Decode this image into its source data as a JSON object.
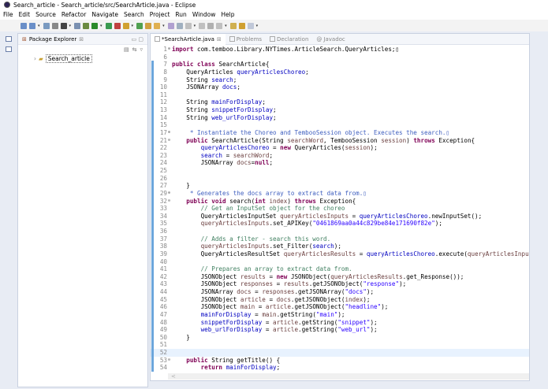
{
  "window": {
    "title": "Search_article - Search_article/src/SearchArticle.java - Eclipse"
  },
  "menu": [
    "File",
    "Edit",
    "Source",
    "Refactor",
    "Navigate",
    "Search",
    "Project",
    "Run",
    "Window",
    "Help"
  ],
  "package_explorer": {
    "title": "Package Explorer",
    "close": "⊠",
    "project": "Search_article"
  },
  "tabs": [
    {
      "label": "*SearchArticle.java",
      "active": true
    },
    {
      "label": "Problems"
    },
    {
      "label": "Declaration"
    },
    {
      "label": "Javadoc"
    }
  ],
  "code": [
    {
      "n": "1",
      "m": "⊕",
      "t": [
        [
          "k",
          "import "
        ],
        [
          "t",
          "com.temboo.Library.NYTimes.ArticleSearch.QueryArticles;▯"
        ]
      ]
    },
    {
      "n": "6",
      "t": []
    },
    {
      "n": "7",
      "t": [
        [
          "k",
          "public class "
        ],
        [
          "t",
          "SearchArticle{"
        ]
      ]
    },
    {
      "n": "8",
      "t": [
        [
          "t",
          "    QueryArticles "
        ],
        [
          "f",
          "queryArticlesChoreo"
        ],
        [
          "t",
          ";"
        ]
      ]
    },
    {
      "n": "9",
      "t": [
        [
          "t",
          "    String "
        ],
        [
          "f",
          "search"
        ],
        [
          "t",
          ";"
        ]
      ]
    },
    {
      "n": "10",
      "t": [
        [
          "t",
          "    JSONArray "
        ],
        [
          "f",
          "docs"
        ],
        [
          "t",
          ";"
        ]
      ]
    },
    {
      "n": "11",
      "t": []
    },
    {
      "n": "12",
      "t": [
        [
          "t",
          "    String "
        ],
        [
          "f",
          "mainForDisplay"
        ],
        [
          "t",
          ";"
        ]
      ]
    },
    {
      "n": "13",
      "t": [
        [
          "t",
          "    String "
        ],
        [
          "f",
          "snippetForDisplay"
        ],
        [
          "t",
          ";"
        ]
      ]
    },
    {
      "n": "14",
      "t": [
        [
          "t",
          "    String "
        ],
        [
          "f",
          "web_urlForDisplay"
        ],
        [
          "t",
          ";"
        ]
      ]
    },
    {
      "n": "15",
      "t": []
    },
    {
      "n": "17",
      "m": "⊕",
      "t": [
        [
          "jd",
          "     * Instantiate the Choreo and TembooSession object. Executes the search.▯"
        ]
      ]
    },
    {
      "n": "21",
      "m": "⊖",
      "t": [
        [
          "k",
          "    public "
        ],
        [
          "t",
          "SearchArticle(String "
        ],
        [
          "v",
          "searchWord"
        ],
        [
          "t",
          ", TembooSession "
        ],
        [
          "v",
          "session"
        ],
        [
          "t",
          ") "
        ],
        [
          "k",
          "throws "
        ],
        [
          "t",
          "Exception{"
        ]
      ]
    },
    {
      "n": "22",
      "t": [
        [
          "f",
          "        queryArticlesChoreo"
        ],
        [
          "t",
          " = "
        ],
        [
          "k",
          "new "
        ],
        [
          "t",
          "QueryArticles("
        ],
        [
          "v",
          "session"
        ],
        [
          "t",
          ");"
        ]
      ]
    },
    {
      "n": "23",
      "t": [
        [
          "f",
          "        search"
        ],
        [
          "t",
          " = "
        ],
        [
          "v",
          "searchWord"
        ],
        [
          "t",
          ";"
        ]
      ]
    },
    {
      "n": "24",
      "t": [
        [
          "t",
          "        JSONArray "
        ],
        [
          "v",
          "docs"
        ],
        [
          "t",
          "="
        ],
        [
          "k",
          "null"
        ],
        [
          "t",
          ";"
        ]
      ]
    },
    {
      "n": "25",
      "t": []
    },
    {
      "n": "26",
      "t": []
    },
    {
      "n": "27",
      "t": [
        [
          "t",
          "    }"
        ]
      ]
    },
    {
      "n": "29",
      "m": "⊕",
      "t": [
        [
          "jd",
          "     * Generates the docs array to extract data from.▯"
        ]
      ]
    },
    {
      "n": "32",
      "m": "⊖",
      "t": [
        [
          "k",
          "    public void "
        ],
        [
          "t",
          "search("
        ],
        [
          "k",
          "int "
        ],
        [
          "v",
          "index"
        ],
        [
          "t",
          ") "
        ],
        [
          "k",
          "throws "
        ],
        [
          "t",
          "Exception{"
        ]
      ]
    },
    {
      "n": "33",
      "t": [
        [
          "c",
          "        // Get an InputSet object for the choreo"
        ]
      ]
    },
    {
      "n": "34",
      "t": [
        [
          "t",
          "        QueryArticlesInputSet "
        ],
        [
          "v",
          "queryArticlesInputs"
        ],
        [
          "t",
          " = "
        ],
        [
          "f",
          "queryArticlesChoreo"
        ],
        [
          "t",
          ".newInputSet();"
        ]
      ]
    },
    {
      "n": "35",
      "t": [
        [
          "v",
          "        queryArticlesInputs"
        ],
        [
          "t",
          ".set_APIKey("
        ],
        [
          "s",
          "\"0461869aa0a44c829be84e171690f82e\""
        ],
        [
          "t",
          ");"
        ]
      ]
    },
    {
      "n": "36",
      "t": []
    },
    {
      "n": "37",
      "t": [
        [
          "c",
          "        // Adds a filter - search this word."
        ]
      ]
    },
    {
      "n": "38",
      "t": [
        [
          "v",
          "        queryArticlesInputs"
        ],
        [
          "t",
          ".set_Filter("
        ],
        [
          "f",
          "search"
        ],
        [
          "t",
          ");"
        ]
      ]
    },
    {
      "n": "39",
      "t": [
        [
          "t",
          "        QueryArticlesResultSet "
        ],
        [
          "v",
          "queryArticlesResults"
        ],
        [
          "t",
          " = "
        ],
        [
          "f",
          "queryArticlesChoreo"
        ],
        [
          "t",
          ".execute("
        ],
        [
          "v",
          "queryArticlesInputs"
        ],
        [
          "t",
          ");"
        ]
      ]
    },
    {
      "n": "40",
      "t": []
    },
    {
      "n": "41",
      "t": [
        [
          "c",
          "        // Prepares an array to extract data from."
        ]
      ]
    },
    {
      "n": "42",
      "t": [
        [
          "t",
          "        JSONObject "
        ],
        [
          "v",
          "results"
        ],
        [
          "t",
          " = "
        ],
        [
          "k",
          "new "
        ],
        [
          "t",
          "JSONObject("
        ],
        [
          "v",
          "queryArticlesResults"
        ],
        [
          "t",
          ".get_Response());"
        ]
      ]
    },
    {
      "n": "43",
      "t": [
        [
          "t",
          "        JSONObject "
        ],
        [
          "v",
          "responses"
        ],
        [
          "t",
          " = "
        ],
        [
          "v",
          "results"
        ],
        [
          "t",
          ".getJSONObject("
        ],
        [
          "s",
          "\"response\""
        ],
        [
          "t",
          ");"
        ]
      ]
    },
    {
      "n": "44",
      "t": [
        [
          "t",
          "        JSONArray "
        ],
        [
          "v",
          "docs"
        ],
        [
          "t",
          " = "
        ],
        [
          "v",
          "responses"
        ],
        [
          "t",
          ".getJSONArray("
        ],
        [
          "s",
          "\"docs\""
        ],
        [
          "t",
          ");"
        ]
      ]
    },
    {
      "n": "45",
      "t": [
        [
          "t",
          "        JSONObject "
        ],
        [
          "v",
          "article"
        ],
        [
          "t",
          " = "
        ],
        [
          "v",
          "docs"
        ],
        [
          "t",
          ".getJSONObject("
        ],
        [
          "v",
          "index"
        ],
        [
          "t",
          ");"
        ]
      ]
    },
    {
      "n": "46",
      "t": [
        [
          "t",
          "        JSONObject "
        ],
        [
          "v",
          "main"
        ],
        [
          "t",
          " = "
        ],
        [
          "v",
          "article"
        ],
        [
          "t",
          ".getJSONObject("
        ],
        [
          "s",
          "\"headline\""
        ],
        [
          "t",
          ");"
        ]
      ]
    },
    {
      "n": "47",
      "t": [
        [
          "f",
          "        mainForDisplay"
        ],
        [
          "t",
          " = "
        ],
        [
          "v",
          "main"
        ],
        [
          "t",
          ".getString("
        ],
        [
          "s",
          "\"main\""
        ],
        [
          "t",
          ");"
        ]
      ]
    },
    {
      "n": "48",
      "t": [
        [
          "f",
          "        snippetForDisplay"
        ],
        [
          "t",
          " = "
        ],
        [
          "v",
          "article"
        ],
        [
          "t",
          ".getString("
        ],
        [
          "s",
          "\"snippet\""
        ],
        [
          "t",
          ");"
        ]
      ]
    },
    {
      "n": "49",
      "t": [
        [
          "f",
          "        web_urlForDisplay"
        ],
        [
          "t",
          " = "
        ],
        [
          "v",
          "article"
        ],
        [
          "t",
          ".getString("
        ],
        [
          "s",
          "\"web_url\""
        ],
        [
          "t",
          ");"
        ]
      ]
    },
    {
      "n": "50",
      "t": [
        [
          "t",
          "    }"
        ]
      ]
    },
    {
      "n": "51",
      "t": []
    },
    {
      "n": "52",
      "cur": true,
      "t": []
    },
    {
      "n": "53",
      "m": "⊖",
      "t": [
        [
          "k",
          "    public "
        ],
        [
          "t",
          "String getTitle() {"
        ]
      ]
    },
    {
      "n": "54",
      "t": [
        [
          "k",
          "        return "
        ],
        [
          "f",
          "mainForDisplay"
        ],
        [
          "t",
          ";"
        ]
      ]
    }
  ],
  "scroll_left": "<"
}
